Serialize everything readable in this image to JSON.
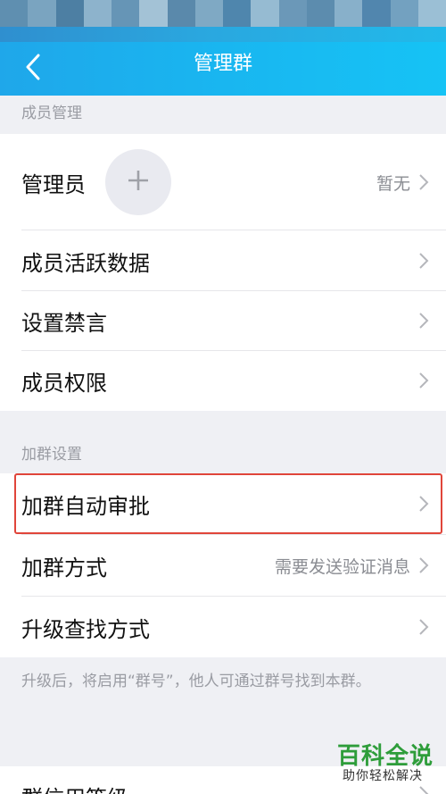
{
  "header": {
    "title": "管理群",
    "back_icon": "chevron-left-icon"
  },
  "colors": {
    "nav_bar": "#19b6f0",
    "highlight_border": "#e0453a",
    "watermark_green": "#2e9d3a"
  },
  "sections": {
    "member_management": {
      "label": "成员管理",
      "admin": {
        "label": "管理员",
        "value": "暂无",
        "add_icon": "plus-icon"
      },
      "items": [
        {
          "label": "成员活跃数据"
        },
        {
          "label": "设置禁言"
        },
        {
          "label": "成员权限"
        }
      ]
    },
    "join_settings": {
      "label": "加群设置",
      "items": [
        {
          "label": "加群自动审批",
          "value": ""
        },
        {
          "label": "加群方式",
          "value": "需要发送验证消息"
        },
        {
          "label": "升级查找方式",
          "value": ""
        }
      ]
    }
  },
  "hint": "升级后，将启用“群号”，他人可通过群号找到本群。",
  "partial_row": {
    "label": "群信用等级"
  },
  "watermark": {
    "title": "百科全说",
    "subtitle": "助你轻松解决"
  }
}
